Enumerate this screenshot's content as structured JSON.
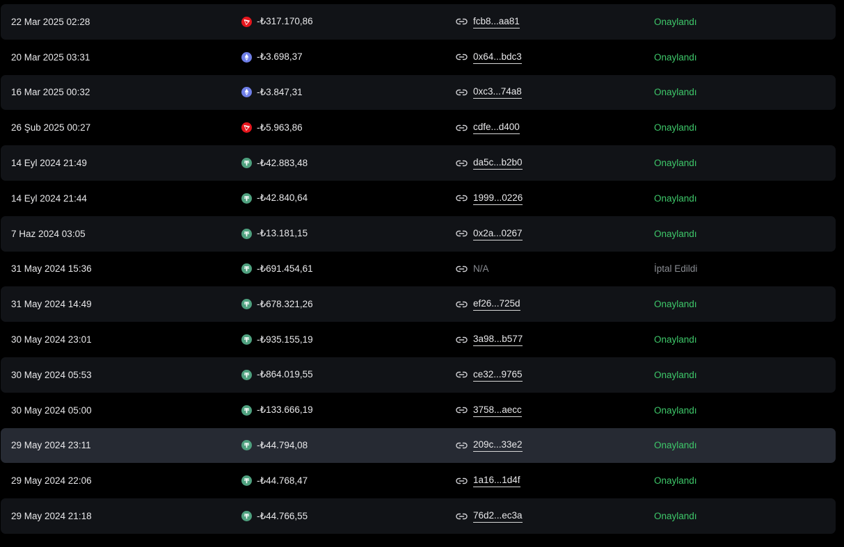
{
  "accent_colors": {
    "confirmed": "#3ec86a",
    "cancelled": "#8a8d93",
    "tron": "#e5161d",
    "eth": "#6f7fe8",
    "usdt": "#4fa17f"
  },
  "rows": [
    {
      "date": "22 Mar 2025 02:28",
      "coin": "tron-icon",
      "amount": "-₺317.170,86",
      "hash": "fcb8...aa81",
      "status": "Onaylandı",
      "state": "confirmed"
    },
    {
      "date": "20 Mar 2025 03:31",
      "coin": "ethereum-icon",
      "amount": "-₺3.698,37",
      "hash": "0x64...bdc3",
      "status": "Onaylandı",
      "state": "confirmed"
    },
    {
      "date": "16 Mar 2025 00:32",
      "coin": "ethereum-icon",
      "amount": "-₺3.847,31",
      "hash": "0xc3...74a8",
      "status": "Onaylandı",
      "state": "confirmed"
    },
    {
      "date": "26 Şub 2025 00:27",
      "coin": "tron-icon",
      "amount": "-₺5.963,86",
      "hash": "cdfe...d400",
      "status": "Onaylandı",
      "state": "confirmed"
    },
    {
      "date": "14 Eyl 2024 21:49",
      "coin": "tether-icon",
      "amount": "-₺42.883,48",
      "hash": "da5c...b2b0",
      "status": "Onaylandı",
      "state": "confirmed"
    },
    {
      "date": "14 Eyl 2024 21:44",
      "coin": "tether-icon",
      "amount": "-₺42.840,64",
      "hash": "1999...0226",
      "status": "Onaylandı",
      "state": "confirmed"
    },
    {
      "date": "7 Haz 2024 03:05",
      "coin": "tether-icon",
      "amount": "-₺13.181,15",
      "hash": "0x2a...0267",
      "status": "Onaylandı",
      "state": "confirmed"
    },
    {
      "date": "31 May 2024 15:36",
      "coin": "tether-icon",
      "amount": "-₺691.454,61",
      "hash": "N/A",
      "status": "İptal Edildi",
      "state": "cancelled"
    },
    {
      "date": "31 May 2024 14:49",
      "coin": "tether-icon",
      "amount": "-₺678.321,26",
      "hash": "ef26...725d",
      "status": "Onaylandı",
      "state": "confirmed"
    },
    {
      "date": "30 May 2024 23:01",
      "coin": "tether-icon",
      "amount": "-₺935.155,19",
      "hash": "3a98...b577",
      "status": "Onaylandı",
      "state": "confirmed"
    },
    {
      "date": "30 May 2024 05:53",
      "coin": "tether-icon",
      "amount": "-₺864.019,55",
      "hash": "ce32...9765",
      "status": "Onaylandı",
      "state": "confirmed"
    },
    {
      "date": "30 May 2024 05:00",
      "coin": "tether-icon",
      "amount": "-₺133.666,19",
      "hash": "3758...aecc",
      "status": "Onaylandı",
      "state": "confirmed"
    },
    {
      "date": "29 May 2024 23:11",
      "coin": "tether-icon",
      "amount": "-₺44.794,08",
      "hash": "209c...33e2",
      "status": "Onaylandı",
      "state": "confirmed"
    },
    {
      "date": "29 May 2024 22:06",
      "coin": "tether-icon",
      "amount": "-₺44.768,47",
      "hash": "1a16...1d4f",
      "status": "Onaylandı",
      "state": "confirmed"
    },
    {
      "date": "29 May 2024 21:18",
      "coin": "tether-icon",
      "amount": "-₺44.766,55",
      "hash": "76d2...ec3a",
      "status": "Onaylandı",
      "state": "confirmed"
    }
  ]
}
